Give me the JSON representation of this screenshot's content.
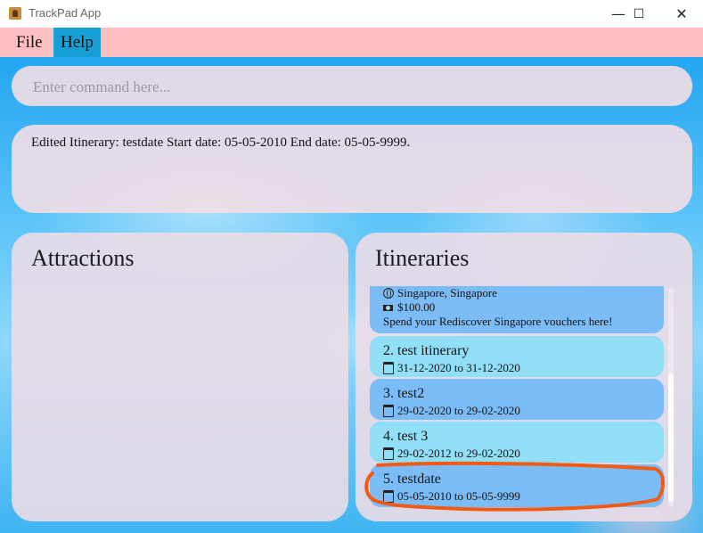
{
  "window": {
    "title": "TrackPad App",
    "controls": {
      "minimize": "—",
      "maximize": "☐",
      "close": "✕"
    }
  },
  "menu": {
    "file": "File",
    "help": "Help"
  },
  "command": {
    "placeholder": "Enter command here...",
    "value": ""
  },
  "result": {
    "text": "Edited Itinerary: testdate Start date: 05-05-2010 End date: 05-05-9999."
  },
  "attractions": {
    "title": "Attractions",
    "items": []
  },
  "itineraries": {
    "title": "Itineraries",
    "partial_card": {
      "location": "Singapore, Singapore",
      "price": "$100.00",
      "description": "Spend your Rediscover Singapore vouchers here!"
    },
    "items": [
      {
        "title": "2.  test itinerary",
        "dates": "31-12-2020 to 31-12-2020"
      },
      {
        "title": "3.  test2",
        "dates": "29-02-2020 to 29-02-2020"
      },
      {
        "title": "4.  test 3",
        "dates": "29-02-2012 to 29-02-2020"
      },
      {
        "title": "5.  testdate",
        "dates": "05-05-2010 to 05-05-9999"
      }
    ]
  },
  "colors": {
    "menubar": "#ffbfc3",
    "menu_help_highlight": "#169fd4",
    "card_light": "#90dff6",
    "card_dark": "#7cbcf6",
    "annotation": "#f05a14"
  },
  "icons": {
    "location": "globe-icon",
    "price": "money-icon",
    "date": "calendar-icon"
  }
}
